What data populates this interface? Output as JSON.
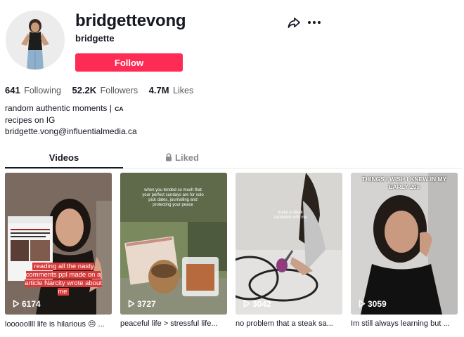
{
  "profile": {
    "username": "bridgettevong",
    "nickname": "bridgette",
    "follow_label": "Follow",
    "stats": [
      {
        "value": "641",
        "label": "Following"
      },
      {
        "value": "52.2K",
        "label": "Followers"
      },
      {
        "value": "4.7M",
        "label": "Likes"
      }
    ],
    "bio": {
      "line1": "random authentic moments | ",
      "country_tag": "CA",
      "line2": "recipes on IG",
      "line3": "bridgette.vong@influentialmedia.ca"
    }
  },
  "tabs": [
    {
      "label": "Videos",
      "active": true
    },
    {
      "label": "Liked",
      "active": false,
      "icon": "lock-icon"
    }
  ],
  "videos": [
    {
      "views": "6174",
      "caption": "looooollll life is hilarious 😔 ...",
      "overlay": "reading all the nasty comments ppl made on a article Narcity wrote about me"
    },
    {
      "views": "3727",
      "caption": "peaceful life > stressful life...",
      "overlay": "when you tended so much that your perfect sundays are for solo pick dates, journalling and protecting your peace"
    },
    {
      "views": "3042",
      "caption": "no problem that a steak sa...",
      "overlay": "make a steak sandwich with me"
    },
    {
      "views": "3059",
      "caption": "Im still always learning but ...",
      "overlay": "THINGS I WISH I KNEW IN MY EARLY 20s"
    }
  ],
  "colors": {
    "accent": "#fe2c55",
    "text": "#161823",
    "muted": "#8a8b91"
  }
}
